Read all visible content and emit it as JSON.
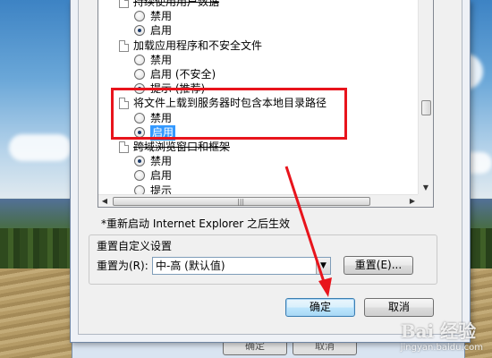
{
  "settings_list": {
    "items": [
      {
        "type": "heading",
        "text": "持续使用用户数据",
        "crossed": true
      },
      {
        "type": "radio",
        "text": "禁用",
        "checked": false
      },
      {
        "type": "radio",
        "text": "启用",
        "checked": true
      },
      {
        "type": "heading",
        "text": "加载应用程序和不安全文件",
        "crossed": false
      },
      {
        "type": "radio",
        "text": "禁用",
        "checked": false
      },
      {
        "type": "radio",
        "text": "启用 (不安全)",
        "checked": false
      },
      {
        "type": "radio",
        "text": "提示 (推荐)",
        "checked": true
      },
      {
        "type": "heading",
        "text": "将文件上载到服务器时包含本地目录路径",
        "crossed": false
      },
      {
        "type": "radio",
        "text": "禁用",
        "checked": false
      },
      {
        "type": "radio",
        "text": "启用",
        "checked": true,
        "selected": true
      },
      {
        "type": "heading",
        "text": "跨域浏览窗口和框架",
        "crossed": true
      },
      {
        "type": "radio",
        "text": "禁用",
        "checked": true
      },
      {
        "type": "radio",
        "text": "启用",
        "checked": false
      },
      {
        "type": "radio",
        "text": "提示",
        "checked": false
      }
    ]
  },
  "restart_note": "*重新启动 Internet Explorer 之后生效",
  "custom_reset": {
    "group_title": "重置自定义设置",
    "reset_to_label": "重置为(R):",
    "reset_level_value": "中-高 (默认值)",
    "reset_button": "重置(E)..."
  },
  "dialog_buttons": {
    "ok": "确定",
    "cancel": "取消"
  },
  "back_window_buttons": [
    "确定",
    "取消"
  ],
  "annotation_colors": {
    "highlight_box": "#e8141c",
    "arrow": "#e8141c"
  },
  "watermark": {
    "main": "Bai 经验",
    "sub": "jingyan.baidu.com"
  }
}
